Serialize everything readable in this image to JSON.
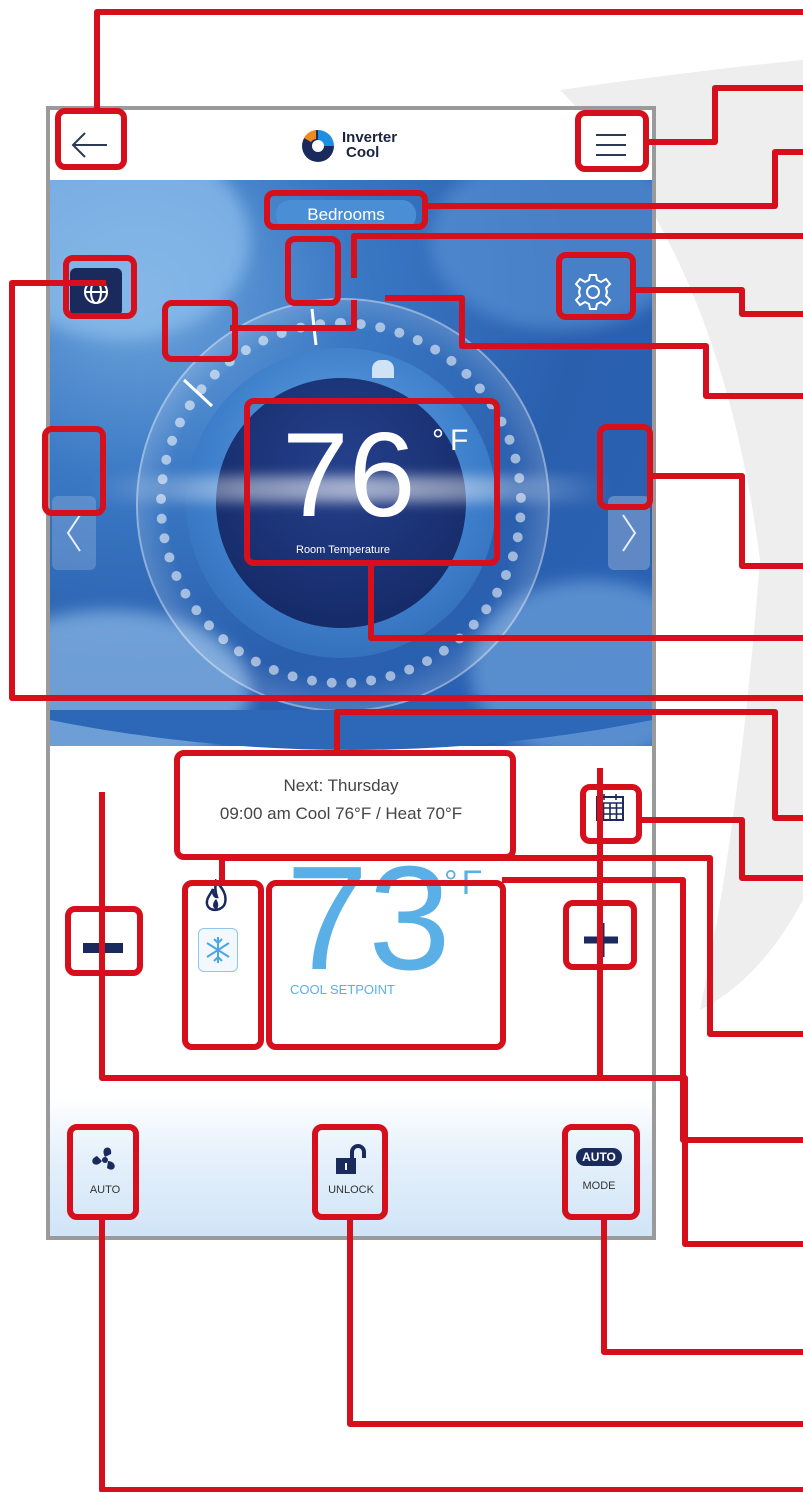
{
  "app": {
    "brand_line1": "Inverter",
    "brand_line2": "Cool",
    "back_icon": "arrow-left-icon",
    "menu_icon": "hamburger-menu-icon"
  },
  "zone": {
    "name": "Bedrooms"
  },
  "dial": {
    "room_temperature": "76",
    "unit": "°F",
    "room_temperature_label": "Room Temperature",
    "prev_icon": "chevron-left-icon",
    "next_icon": "chevron-right-icon",
    "globe_icon": "globe-icon",
    "settings_icon": "gear-icon"
  },
  "schedule": {
    "line1": "Next: Thursday",
    "line2": "09:00 am Cool 76°F / Heat 70°F",
    "calendar_icon": "calendar-icon"
  },
  "setpoint": {
    "value": "73",
    "unit": "°F",
    "label": "COOL SETPOINT",
    "heat_icon": "flame-icon",
    "cool_icon": "snowflake-icon",
    "minus_icon": "minus-icon",
    "plus_icon": "plus-icon"
  },
  "bottom": {
    "fan_label": "AUTO",
    "lock_label": "UNLOCK",
    "mode_badge": "AUTO",
    "mode_label": "MODE"
  },
  "colors": {
    "callout": "#d50f1c",
    "setpoint": "#5ab0e6",
    "navy": "#1b2a5c",
    "accent_orange": "#f08a1c"
  }
}
